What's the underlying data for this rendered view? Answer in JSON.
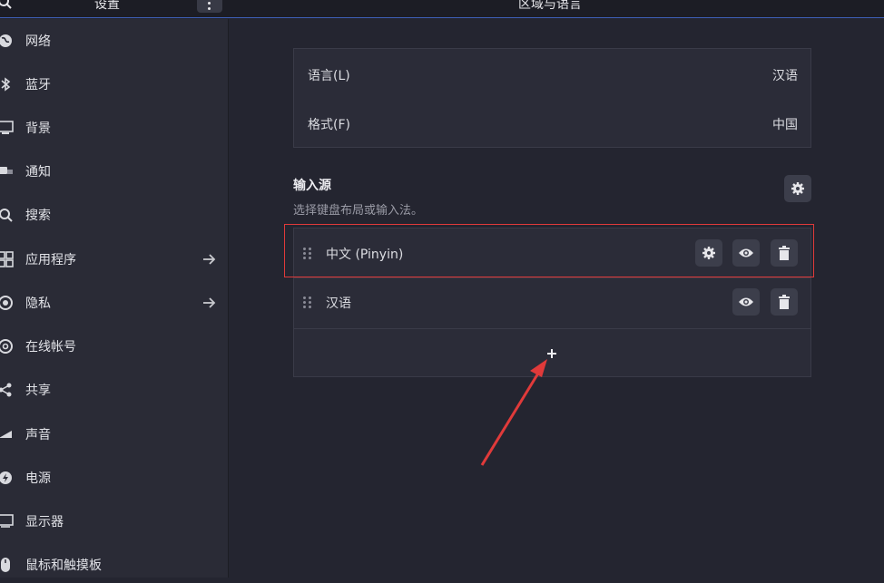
{
  "header": {
    "app_title": "设置",
    "panel_title": "区域与语言"
  },
  "sidebar": {
    "items": [
      {
        "label": "网络",
        "icon": "network-icon"
      },
      {
        "label": "蓝牙",
        "icon": "bluetooth-icon"
      },
      {
        "label": "背景",
        "icon": "background-icon"
      },
      {
        "label": "通知",
        "icon": "notification-icon"
      },
      {
        "label": "搜索",
        "icon": "search-icon"
      },
      {
        "label": "应用程序",
        "icon": "apps-icon"
      },
      {
        "label": "隐私",
        "icon": "privacy-icon"
      },
      {
        "label": "在线帐号",
        "icon": "online-accounts-icon"
      },
      {
        "label": "共享",
        "icon": "share-icon"
      },
      {
        "label": "声音",
        "icon": "sound-icon"
      },
      {
        "label": "电源",
        "icon": "power-icon"
      },
      {
        "label": "显示器",
        "icon": "display-icon"
      },
      {
        "label": "鼠标和触摸板",
        "icon": "mouse-icon"
      }
    ]
  },
  "region": {
    "language_label": "语言(L)",
    "language_value": "汉语",
    "format_label": "格式(F)",
    "format_value": "中国"
  },
  "input_sources": {
    "title": "输入源",
    "subtitle": "选择键盘布局或输入法。",
    "sources": [
      {
        "name": "中文 (Pinyin)"
      },
      {
        "name": "汉语"
      }
    ],
    "add_label": "+"
  },
  "colors": {
    "accent": "#3d5fb8",
    "highlight": "#e03a3a"
  }
}
